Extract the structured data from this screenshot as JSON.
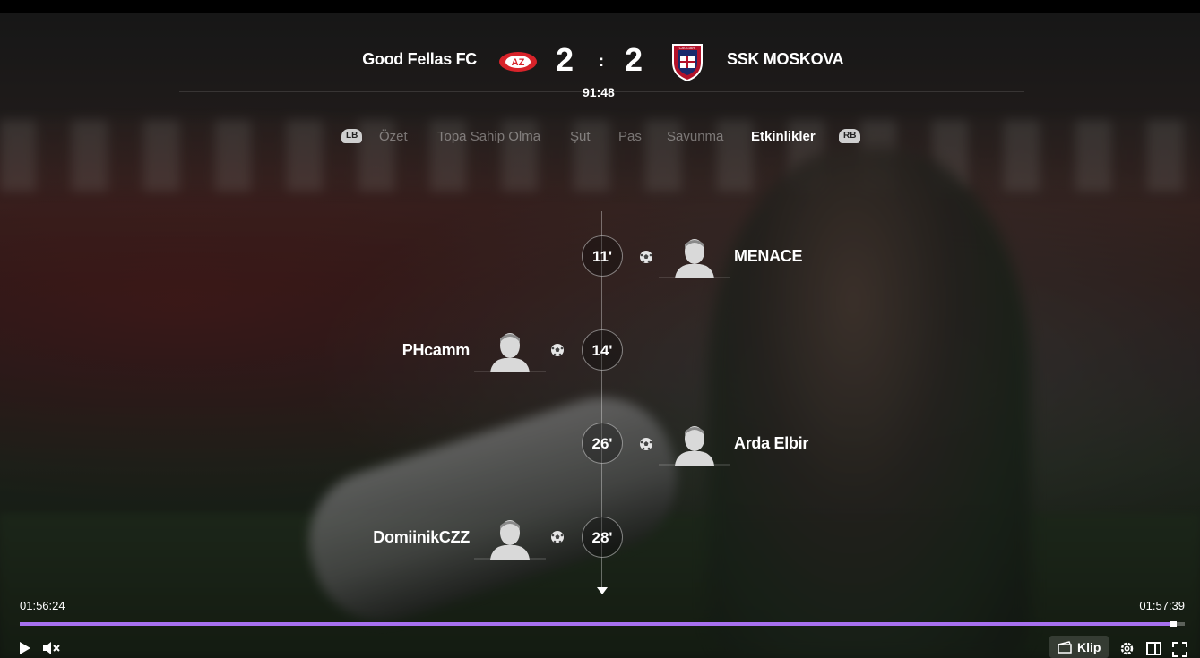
{
  "match": {
    "home_team": "Good Fellas FC",
    "home_crest_text": "AZ",
    "home_score": "2",
    "separator": ":",
    "away_score": "2",
    "away_team": "SSK MOSKOVA",
    "away_crest_text": "CAGLIARI",
    "clock": "91:48"
  },
  "tabs": {
    "left_bumper": "LB",
    "right_bumper": "RB",
    "items": [
      {
        "label": "Özet"
      },
      {
        "label": "Topa Sahip Olma"
      },
      {
        "label": "Şut"
      },
      {
        "label": "Pas"
      },
      {
        "label": "Savunma"
      },
      {
        "label": "Etkinlikler"
      }
    ],
    "active": "Etkinlikler"
  },
  "events": [
    {
      "minute": "11'",
      "player": "MENACE",
      "side": "away",
      "type": "goal",
      "icon": "soccer-ball-icon"
    },
    {
      "minute": "14'",
      "player": "PHcamm",
      "side": "home",
      "type": "goal",
      "icon": "soccer-ball-icon"
    },
    {
      "minute": "26'",
      "player": "Arda Elbir",
      "side": "away",
      "type": "goal",
      "icon": "soccer-ball-icon"
    },
    {
      "minute": "28'",
      "player": "DomiinikCZZ",
      "side": "home",
      "type": "goal",
      "icon": "soccer-ball-icon"
    }
  ],
  "player": {
    "current_time": "01:56:24",
    "total_time": "01:57:39",
    "progress": 0.99,
    "accent_color": "#a770ef",
    "clip_label": "Klip",
    "controls": [
      "play-icon",
      "mute-icon",
      "clip-icon",
      "settings-icon",
      "theater-mode-icon",
      "fullscreen-icon"
    ]
  }
}
